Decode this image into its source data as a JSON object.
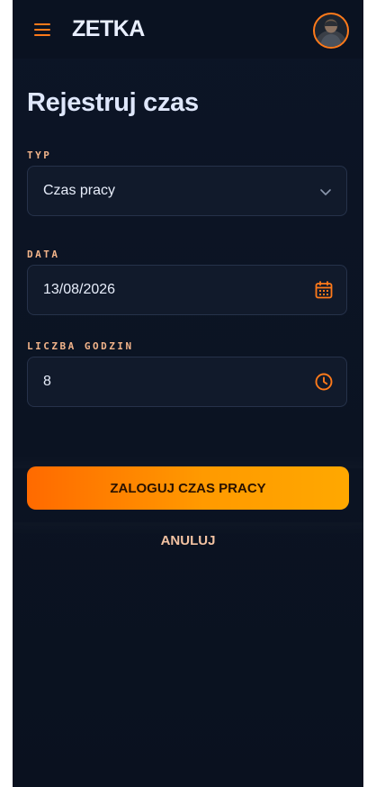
{
  "header": {
    "brand": "ZETKA",
    "menu_icon": "hamburger-menu-icon",
    "avatar_icon": "user-avatar"
  },
  "page": {
    "title": "Rejestruj czas"
  },
  "form": {
    "type": {
      "label": "TYP",
      "value": "Czas pracy",
      "icon": "chevron-down-icon"
    },
    "date": {
      "label": "DATA",
      "value": "13/08/2026",
      "icon": "calendar-icon"
    },
    "hours": {
      "label": "LICZBA GODZIN",
      "value": "8",
      "icon": "clock-icon"
    }
  },
  "actions": {
    "submit_label": "ZALOGUJ CZAS PRACY",
    "cancel_label": "ANULUJ"
  },
  "colors": {
    "accent": "#ff7a1a",
    "background": "#0c1526",
    "field_bg": "#111a2b",
    "label": "#f2b48a"
  }
}
